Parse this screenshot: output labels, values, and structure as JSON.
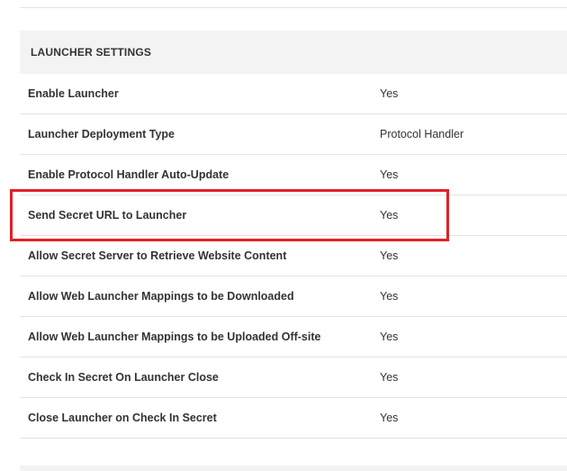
{
  "section": {
    "title": "LAUNCHER SETTINGS",
    "rows": [
      {
        "label": "Enable Launcher",
        "value": "Yes"
      },
      {
        "label": "Launcher Deployment Type",
        "value": "Protocol Handler"
      },
      {
        "label": "Enable Protocol Handler Auto-Update",
        "value": "Yes"
      },
      {
        "label": "Send Secret URL to Launcher",
        "value": "Yes"
      },
      {
        "label": "Allow Secret Server to Retrieve Website Content",
        "value": "Yes"
      },
      {
        "label": "Allow Web Launcher Mappings to be Downloaded",
        "value": "Yes"
      },
      {
        "label": "Allow Web Launcher Mappings to be Uploaded Off-site",
        "value": "Yes"
      },
      {
        "label": "Check In Secret On Launcher Close",
        "value": "Yes"
      },
      {
        "label": "Close Launcher on Check In Secret",
        "value": "Yes"
      }
    ]
  },
  "highlight": {
    "color": "#e02128",
    "target_row": "Send Secret URL to Launcher"
  }
}
